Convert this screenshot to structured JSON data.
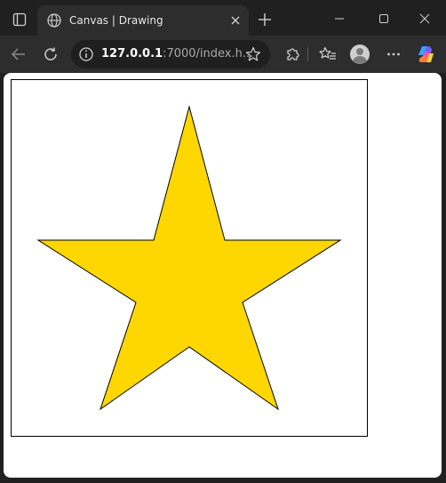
{
  "browser": {
    "tab": {
      "title": "Canvas | Drawing"
    },
    "address_bar": {
      "url_host": "127.0.0.1",
      "url_rest": ":7000/index.h..."
    },
    "colors": {
      "frame": "#202020",
      "toolbar": "#2d2d2d",
      "icon": "#d0d0d0"
    }
  },
  "page": {
    "canvas": {
      "shape": "five-pointed star",
      "fill": "#FFD700",
      "stroke": "#000000",
      "border": "#000000"
    }
  }
}
